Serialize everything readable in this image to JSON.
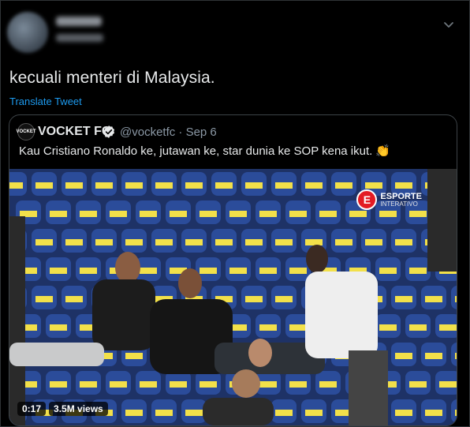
{
  "tweet": {
    "text": "kecuali menteri di Malaysia.",
    "translate_label": "Translate Tweet"
  },
  "quote": {
    "logo_text": "VOCKET",
    "name": "VOCKET FC",
    "handle_date": "@vocketfc · Sep 6",
    "text": "Kau Cristiano Ronaldo ke, jutawan ke, star dunia ke SOP kena ikut.",
    "clap_emoji": "👏"
  },
  "video": {
    "duration": "0:17",
    "views": "3.5M views",
    "watermark_main": "ESPORTE",
    "watermark_sub": "INTERATIVO",
    "watermark_letter": "E"
  },
  "colors": {
    "background": "#000000",
    "link": "#1d9bf0",
    "seat_blue": "#2b4c9a",
    "seat_label": "#f2e04a"
  }
}
